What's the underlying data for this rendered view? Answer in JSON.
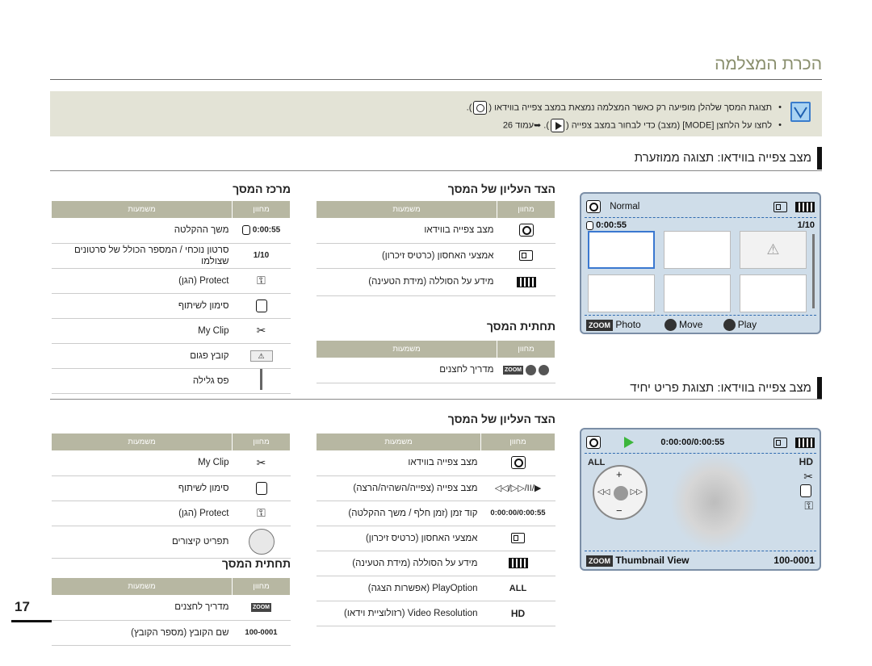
{
  "page": {
    "title": "הכרת המצלמה",
    "number": "17"
  },
  "note": {
    "line1": "תצוגת המסך שלהלן מופיעה רק כאשר המצלמה נמצאת במצב צפייה בווידאו (",
    "line1_end": ").",
    "line2": "לחצו על הלחצן [MODE] (מצב) כדי לבחור במצב צפייה (",
    "line2_end": "). ➥עמוד 26"
  },
  "sections": {
    "s1_title": "מצב צפייה בווידאו: תצוגה ממוזערת",
    "s2_title": "מצב צפייה בווידאו: תצוגת פריט יחיד"
  },
  "table_labels": {
    "top": "הצד העליון של המסך",
    "middle": "מרכז המסך",
    "bottom": "תחתית המסך",
    "col_indicator": "מחוון",
    "col_meaning": "משמעות"
  },
  "t1_top": [
    {
      "icon": "video-play-mode-icon",
      "text": "מצב צפייה בווידאו"
    },
    {
      "icon": "memory-card-icon",
      "text": "אמצעי האחסון (כרטיס זיכרון)"
    },
    {
      "icon": "battery-icon",
      "text": "מידע על הסוללה (מידת הטעינה)"
    }
  ],
  "t1_mid": [
    {
      "indicator": "0:00:55",
      "text": "משך ההקלטה"
    },
    {
      "indicator": "1/10",
      "text": "סרטון נוכחי / המספר הכולל של סרטונים שצולמו"
    },
    {
      "indicator": "key",
      "text": "Protect (הגן)"
    },
    {
      "indicator": "share",
      "text": "סימון לשיתוף"
    },
    {
      "indicator": "clip",
      "text": "My Clip"
    },
    {
      "indicator": "warning",
      "text": "קובץ פגום"
    },
    {
      "indicator": "bar",
      "text": "פס גלילה"
    }
  ],
  "t1_bottom": [
    {
      "indicator": "ZOOM",
      "text": "מדריך לחצנים"
    }
  ],
  "t2_top": [
    {
      "icon": "video-play-mode-icon",
      "text": "מצב צפייה בווידאו"
    },
    {
      "indicator": "◁◁/▷▷/II/▶",
      "text": "מצב צפייה (צפייה/השהיה/הרצה)"
    },
    {
      "indicator": "0:00:00/0:00:55",
      "text": "קוד זמן (זמן חלף / משך ההקלטה)"
    },
    {
      "icon": "memory-card-icon",
      "text": "אמצעי האחסון (כרטיס זיכרון)"
    },
    {
      "icon": "battery-icon",
      "text": "מידע על הסוללה (מידת הטעינה)"
    },
    {
      "indicator": "ALL",
      "text": "PlayOption (אפשרות הצגה)"
    },
    {
      "indicator": "HD",
      "text": "Video Resolution (רזולוציית וידאו)"
    }
  ],
  "t2_mid": [
    {
      "indicator": "clip",
      "text": "My Clip"
    },
    {
      "indicator": "share",
      "text": "סימון לשיתוף"
    },
    {
      "indicator": "key",
      "text": "Protect (הגן)"
    },
    {
      "indicator": "pad",
      "text": "תפריט קיצורים"
    }
  ],
  "t2_bottom": [
    {
      "indicator": "ZOOM",
      "text": "מדריך לחצנים"
    },
    {
      "indicator": "100-0001",
      "text": "שם הקובץ (מספר הקובץ)"
    }
  ],
  "panel1": {
    "mode": "Normal",
    "time": "0:00:55",
    "count": "1/10",
    "zoom": "ZOOM",
    "photo": "Photo",
    "move": "Move",
    "play": "Play"
  },
  "panel2": {
    "timecode": "0:00:00/0:00:55",
    "zoom": "ZOOM",
    "thumb": "Thumbnail View",
    "file": "100-0001",
    "hd": "HD"
  }
}
